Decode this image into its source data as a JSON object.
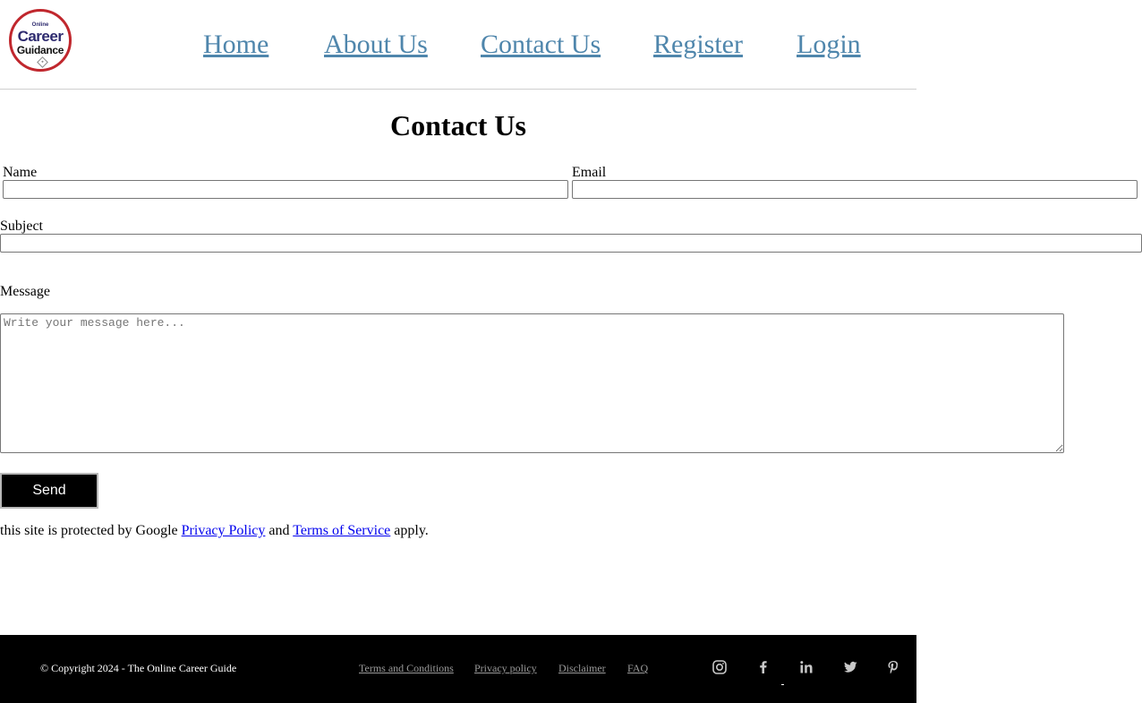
{
  "header": {
    "logo": {
      "small": "Online",
      "main": "Career",
      "sub": "Guidance"
    },
    "nav": [
      {
        "label": "Home"
      },
      {
        "label": "About Us"
      },
      {
        "label": "Contact Us"
      },
      {
        "label": "Register"
      },
      {
        "label": "Login"
      }
    ]
  },
  "main": {
    "title": "Contact Us",
    "form": {
      "name_label": "Name",
      "name_value": "",
      "email_label": "Email",
      "email_value": "",
      "subject_label": "Subject",
      "subject_value": "",
      "message_label": "Message",
      "message_placeholder": "Write your message here...",
      "send_label": "Send"
    },
    "notice": {
      "prefix": "this site is protected by Google ",
      "privacy_link": "Privacy Policy",
      "middle": " and ",
      "terms_link": "Terms of Service",
      "suffix": " apply."
    }
  },
  "footer": {
    "copyright": "© Copyright 2024 - The Online Career Guide",
    "links": [
      {
        "label": "Terms and Conditions"
      },
      {
        "label": "Privacy policy"
      },
      {
        "label": "Disclaimer"
      },
      {
        "label": "FAQ"
      }
    ],
    "social_icons": [
      "instagram-icon",
      "facebook-icon",
      "linkedin-icon",
      "twitter-icon",
      "pinterest-icon"
    ]
  },
  "colors": {
    "nav_link": "#4f86ac",
    "logo_ring": "#c0272d",
    "logo_text": "#2d2a6e",
    "footer_bg": "#000000",
    "footer_link": "#9a9a9a",
    "social_icon": "#c8c8c8"
  }
}
